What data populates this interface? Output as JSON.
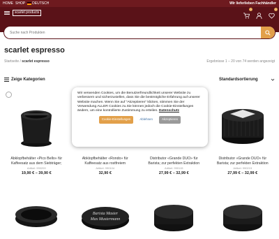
{
  "topbar": {
    "links": [
      "HOME",
      "SHOP",
      "DEUTSCH"
    ],
    "tagline": "Wir lieferlieben Fachhändler"
  },
  "header": {
    "logo_text": "scarlet products",
    "cart_count": "0",
    "wishlist_count": "0"
  },
  "search": {
    "placeholder": "Suche nach Produkten"
  },
  "page": {
    "title": "scarlet espresso",
    "breadcrumb_home": "Startseite",
    "breadcrumb_sep": "/",
    "breadcrumb_current": "scarlet espresso",
    "result_count": "Ergebnisse 1 – 20 von 74 werden angezeigt"
  },
  "filters": {
    "label": "Zeige Kategorien"
  },
  "sort": {
    "label": "Standardsortierung"
  },
  "products": [
    {
      "name": "Abklopfbehälter «Pico Bello» für Kaffeesatz aus dem Siebträger;",
      "article": "Artikel: 990209",
      "price": "19,90 € – 39,90 €"
    },
    {
      "name": "Abklopfbehälter «Rondo» für Kaffeesatz aus rostfreiem",
      "article": "Artikel: 990104",
      "price": "32,90 €"
    },
    {
      "name": "Distributor «Grande DUO» für Barista; zur perfekten Extraktion",
      "article": "Artikel: 990115",
      "price": "27,99 € – 32,99 €"
    },
    {
      "name": "Distributor «Grande DUO» für Barista; zur perfekten Extraktion",
      "article": "Artikel: 990215",
      "price": "27,99 € – 32,99 €"
    }
  ],
  "tamper_engraving": {
    "line1": "Barista Master",
    "line2": "Max Mustermann"
  },
  "cookie": {
    "text": "Wir verwenden Cookies, um die Benutzerfreundlichkeit unserer Website zu verbessern und sicherzustellen, dass Sie die bestmögliche Erfahrung auf unserer Website machen. Wenn Sie auf \"Akzeptieren\" klicken, stimmen Sie der Verwendung ALLER Cookies zu.Sie können jedoch die Cookie-Einstellungen ändern, um eine kontrollierte Zustimmung zu erteilen.",
    "privacy_link": "Datenschutz",
    "settings_label": "Cookie-Einstellungen",
    "reject_label": "Ablehnen",
    "accept_label": "Akzeptieren"
  },
  "colors": {
    "brand": "#5a1218",
    "accent": "#e2a04a"
  }
}
